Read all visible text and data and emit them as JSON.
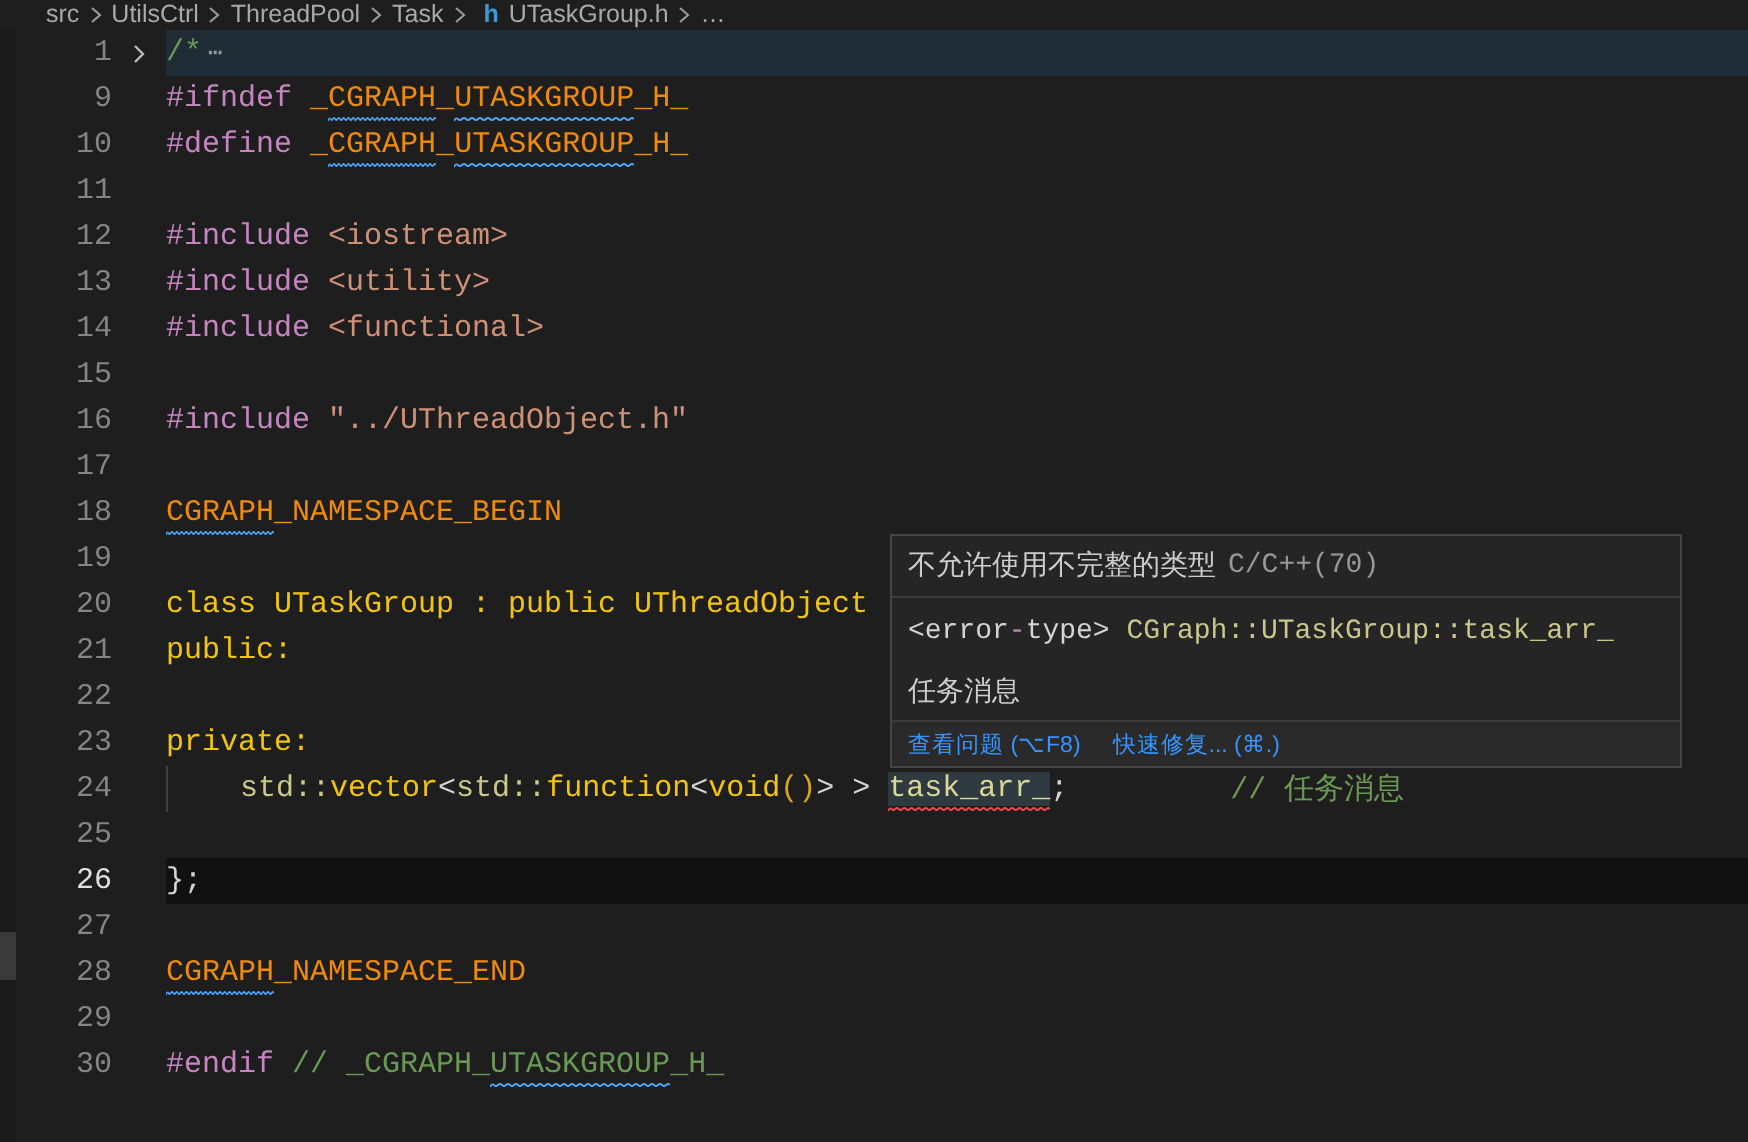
{
  "breadcrumb": [
    {
      "text": "src",
      "kind": "folder"
    },
    {
      "text": "UtilsCtrl",
      "kind": "folder"
    },
    {
      "text": "ThreadPool",
      "kind": "folder"
    },
    {
      "text": "Task",
      "kind": "folder"
    },
    {
      "text": "UTaskGroup.h",
      "kind": "file",
      "icon": "h"
    },
    {
      "text": "…",
      "kind": "folder"
    }
  ],
  "lines": [
    {
      "number": "1",
      "folded": true,
      "fold_marker": "⋯",
      "current": false,
      "tokens": [
        {
          "text": "/*",
          "kind": "comment"
        }
      ]
    },
    {
      "number": "9",
      "folded": false,
      "current": false,
      "tokens": [
        {
          "text": "#ifndef ",
          "kind": "directive"
        },
        {
          "text": "_",
          "kind": "macro"
        },
        {
          "text": "CGRAPH",
          "kind": "macro",
          "info_squiggle": true
        },
        {
          "text": "_",
          "kind": "macro"
        },
        {
          "text": "UTASKGROUP",
          "kind": "macro",
          "info_squiggle": true
        },
        {
          "text": "_H_",
          "kind": "macro"
        }
      ]
    },
    {
      "number": "10",
      "folded": false,
      "current": false,
      "tokens": [
        {
          "text": "#define ",
          "kind": "directive"
        },
        {
          "text": "_",
          "kind": "macro"
        },
        {
          "text": "CGRAPH",
          "kind": "macro",
          "info_squiggle": true
        },
        {
          "text": "_",
          "kind": "macro"
        },
        {
          "text": "UTASKGROUP",
          "kind": "macro",
          "info_squiggle": true
        },
        {
          "text": "_H_",
          "kind": "macro"
        }
      ]
    },
    {
      "number": "11",
      "folded": false,
      "current": false
    },
    {
      "number": "12",
      "folded": false,
      "current": false,
      "tokens": [
        {
          "text": "#include ",
          "kind": "directive"
        },
        {
          "text": "<iostream>",
          "kind": "string"
        }
      ]
    },
    {
      "number": "13",
      "folded": false,
      "current": false,
      "tokens": [
        {
          "text": "#include ",
          "kind": "directive"
        },
        {
          "text": "<utility>",
          "kind": "string"
        }
      ]
    },
    {
      "number": "14",
      "folded": false,
      "current": false,
      "tokens": [
        {
          "text": "#include ",
          "kind": "directive"
        },
        {
          "text": "<functional>",
          "kind": "string"
        }
      ]
    },
    {
      "number": "15",
      "folded": false,
      "current": false
    },
    {
      "number": "16",
      "folded": false,
      "current": false,
      "tokens": [
        {
          "text": "#include ",
          "kind": "directive"
        },
        {
          "text": "\"../UThreadObject.h\"",
          "kind": "string"
        }
      ]
    },
    {
      "number": "17",
      "folded": false,
      "current": false
    },
    {
      "number": "18",
      "folded": false,
      "current": false,
      "tokens": [
        {
          "text": "CGRAPH",
          "kind": "macro",
          "info_squiggle": true
        },
        {
          "text": "_NAMESPACE_BEGIN",
          "kind": "macro"
        }
      ]
    },
    {
      "number": "19",
      "folded": false,
      "current": false
    },
    {
      "number": "20",
      "folded": false,
      "current": false,
      "tokens": [
        {
          "text": "class UTaskGroup : public UThreadObject",
          "kind": "keyword"
        }
      ]
    },
    {
      "number": "21",
      "folded": false,
      "current": false,
      "tokens": [
        {
          "text": "public:",
          "kind": "keyword"
        }
      ]
    },
    {
      "number": "22",
      "folded": false,
      "current": false
    },
    {
      "number": "23",
      "folded": false,
      "current": false,
      "tokens": [
        {
          "text": "private:",
          "kind": "keyword"
        }
      ]
    },
    {
      "number": "24",
      "folded": false,
      "current": false,
      "indented": true,
      "tokens": [
        {
          "text": "std::",
          "kind": "namespace"
        },
        {
          "text": "vector",
          "kind": "keyword"
        },
        {
          "text": "<",
          "kind": "punct"
        },
        {
          "text": "std::",
          "kind": "namespace"
        },
        {
          "text": "function",
          "kind": "keyword"
        },
        {
          "text": "<",
          "kind": "punct"
        },
        {
          "text": "void",
          "kind": "keyword"
        },
        {
          "text": "()",
          "kind": "paren"
        },
        {
          "text": "> > ",
          "kind": "punct"
        },
        {
          "text": "task_arr_",
          "kind": "variable",
          "error_squiggle": true
        },
        {
          "text": ";         ",
          "kind": "punct"
        },
        {
          "text": "// 任务消息",
          "kind": "comment"
        }
      ]
    },
    {
      "number": "25",
      "folded": false,
      "current": false
    },
    {
      "number": "26",
      "folded": false,
      "current": true,
      "tokens": [
        {
          "text": "};",
          "kind": "punct"
        }
      ]
    },
    {
      "number": "27",
      "folded": false,
      "current": false
    },
    {
      "number": "28",
      "folded": false,
      "current": false,
      "tokens": [
        {
          "text": "CGRAPH",
          "kind": "macro",
          "info_squiggle": true
        },
        {
          "text": "_NAMESPACE_END",
          "kind": "macro"
        }
      ]
    },
    {
      "number": "29",
      "folded": false,
      "current": false
    },
    {
      "number": "30",
      "folded": false,
      "current": false,
      "tokens": [
        {
          "text": "#endif ",
          "kind": "directive"
        },
        {
          "text": "// _CGRAPH_",
          "kind": "comment"
        },
        {
          "text": "UTASKGROUP",
          "kind": "comment",
          "info_squiggle": true
        },
        {
          "text": "_H_",
          "kind": "comment"
        }
      ]
    }
  ],
  "hover": {
    "message": "不允许使用不完整的类型",
    "code": "C/C++(70)",
    "signature": [
      {
        "text": "<error",
        "kind": "punct"
      },
      {
        "text": "-",
        "kind": "directive"
      },
      {
        "text": "type> ",
        "kind": "punct"
      },
      {
        "text": "CGraph::UTaskGroup::task_arr_",
        "kind": "namespace"
      }
    ],
    "description": "任务消息",
    "actions": [
      "查看问题 (⌥F8)",
      "快速修复... (⌘.)"
    ]
  }
}
